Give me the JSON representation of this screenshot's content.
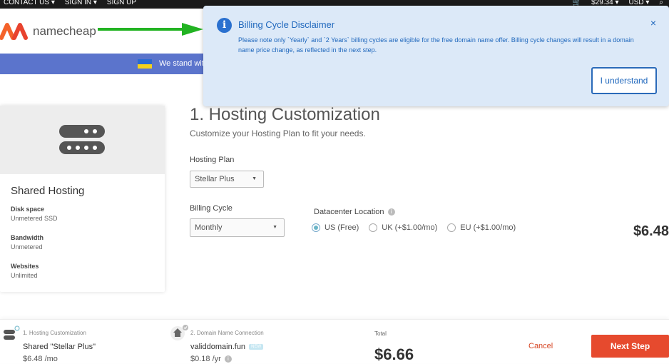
{
  "topbar": {
    "contact": "CONTACT US ▾",
    "signin": "SIGN IN ▾",
    "signup": "SIGN UP",
    "cart": "$29.34 ▾",
    "currency": "USD ▾"
  },
  "brand": {
    "name": "namecheap"
  },
  "banner": {
    "message": "We stand wit"
  },
  "modal": {
    "title": "Billing Cycle Disclaimer",
    "text": "Please note only `Yearly` and `2 Years` billing cycles are eligible for the free domain name offer. Billing cycle changes will result in a domain name price change, as reflected in the next step.",
    "close": "×",
    "button": "I understand"
  },
  "card": {
    "title": "Shared Hosting",
    "specs": [
      {
        "label": "Disk space",
        "value": "Unmetered SSD"
      },
      {
        "label": "Bandwidth",
        "value": "Unmetered"
      },
      {
        "label": "Websites",
        "value": "Unlimited"
      }
    ]
  },
  "main": {
    "title": "1. Hosting Customization",
    "subtitle": "Customize your Hosting Plan to fit your needs.",
    "plan_label": "Hosting Plan",
    "plan_value": "Stellar Plus",
    "cycle_label": "Billing Cycle",
    "cycle_value": "Monthly",
    "datacenter_label": "Datacenter Location",
    "locations": [
      {
        "label": "US (Free)",
        "selected": true
      },
      {
        "label": "UK (+$1.00/mo)",
        "selected": false
      },
      {
        "label": "EU (+$1.00/mo)",
        "selected": false
      }
    ],
    "price": "$6.48"
  },
  "bottom": {
    "step1_label": "1. Hosting Customization",
    "step1_name": "Shared \"Stellar Plus\"",
    "step1_price": "$6.48 /mo",
    "step2_label": "2. Domain Name Connection",
    "step2_name": "validdomain.fun",
    "step2_tag": "NEW",
    "step2_price": "$0.18 /yr",
    "total_label": "Total",
    "total": "$6.66",
    "cancel": "Cancel",
    "next": "Next Step"
  },
  "colors": {
    "accent": "#e64a2e",
    "modal_bg": "#dce9f8",
    "modal_text": "#2068bd",
    "banner": "#5b74cc"
  }
}
